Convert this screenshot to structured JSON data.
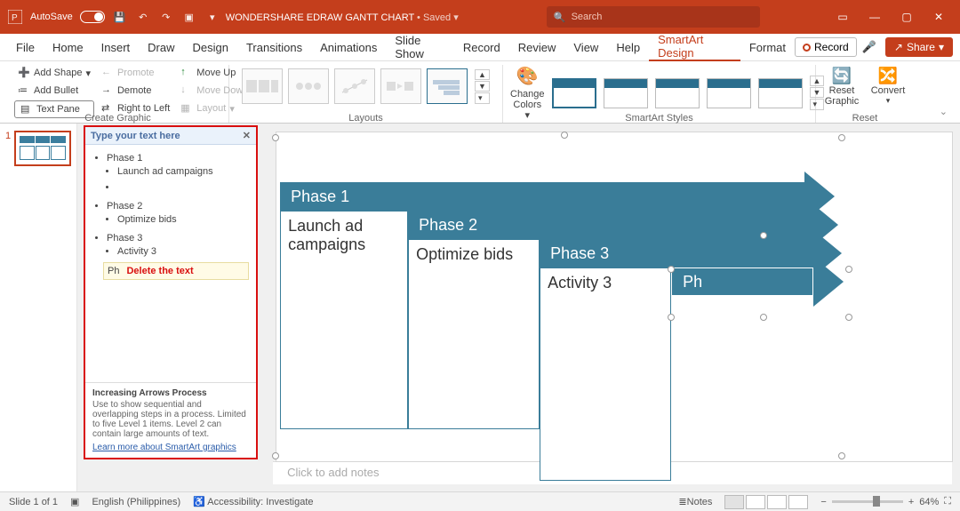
{
  "titlebar": {
    "autosave": "AutoSave",
    "doc_title": "WONDERSHARE EDRAW GANTT CHART",
    "saved_suffix": " • Saved ▾",
    "search_placeholder": "Search"
  },
  "window": {
    "min": "—",
    "max": "▢",
    "close": "✕"
  },
  "menu": {
    "file": "File",
    "home": "Home",
    "insert": "Insert",
    "draw": "Draw",
    "design": "Design",
    "transitions": "Transitions",
    "animations": "Animations",
    "slideshow": "Slide Show",
    "record": "Record",
    "review": "Review",
    "view": "View",
    "help": "Help",
    "smartart": "SmartArt Design",
    "format": "Format",
    "record_btn": "Record",
    "share": "Share"
  },
  "ribbon": {
    "add_shape": "Add Shape",
    "add_bullet": "Add Bullet",
    "text_pane": "Text Pane",
    "promote": "Promote",
    "demote": "Demote",
    "right_to_left": "Right to Left",
    "move_up": "Move Up",
    "move_down": "Move Down",
    "layout": "Layout",
    "group_create": "Create Graphic",
    "group_layouts": "Layouts",
    "change_colors": "Change Colors",
    "group_styles": "SmartArt Styles",
    "reset_graphic": "Reset Graphic",
    "convert": "Convert",
    "group_reset": "Reset"
  },
  "text_pane": {
    "header": "Type your text here",
    "items": {
      "p1": "Phase 1",
      "p1a": "Launch ad campaigns",
      "p2": "Phase 2",
      "p2a": "Optimize bids",
      "p3": "Phase 3",
      "p3a": "Activity 3",
      "p4": "Ph"
    },
    "annotation": "Delete the text",
    "footer_title": "Increasing Arrows Process",
    "footer_desc": "Use to show sequential and overlapping steps in a process. Limited to five Level 1 items. Level 2 can contain large amounts of text.",
    "footer_link": "Learn more about SmartArt graphics"
  },
  "smartart": {
    "p1": "Phase 1",
    "p1_body": "Launch ad campaigns",
    "p2": "Phase 2",
    "p2_body": "Optimize bids",
    "p3": "Phase 3",
    "p3_body": "Activity 3",
    "p4": "Ph"
  },
  "notes": {
    "placeholder": "Click to add notes"
  },
  "status": {
    "slide": "Slide 1 of 1",
    "lang": "English (Philippines)",
    "access": "Accessibility: Investigate",
    "notes_btn": "Notes",
    "zoom_pct": "64%"
  },
  "thumb": {
    "num": "1"
  }
}
